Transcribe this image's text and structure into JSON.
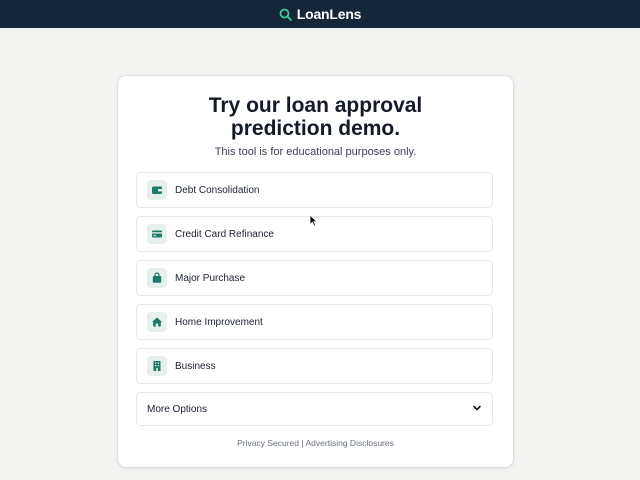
{
  "header": {
    "brand": "LoanLens",
    "logo_icon": "magnifier-icon",
    "background": "#13263a",
    "accent": "#3ecf9a"
  },
  "main": {
    "title_line1": "Try our loan approval",
    "title_line2": "prediction demo.",
    "subtitle": "This tool is for educational purposes only.",
    "options": [
      {
        "label": "Debt Consolidation",
        "icon": "wallet-icon"
      },
      {
        "label": "Credit Card Refinance",
        "icon": "credit-card-icon"
      },
      {
        "label": "Major Purchase",
        "icon": "shopping-bag-icon"
      },
      {
        "label": "Home Improvement",
        "icon": "home-icon"
      },
      {
        "label": "Business",
        "icon": "building-icon"
      }
    ],
    "more_options": "More Options",
    "icon_color": "#1b7a6a"
  },
  "footer": {
    "privacy": "Privacy Secured",
    "separator": "|",
    "disclosures": "Advertising Disclosures"
  }
}
